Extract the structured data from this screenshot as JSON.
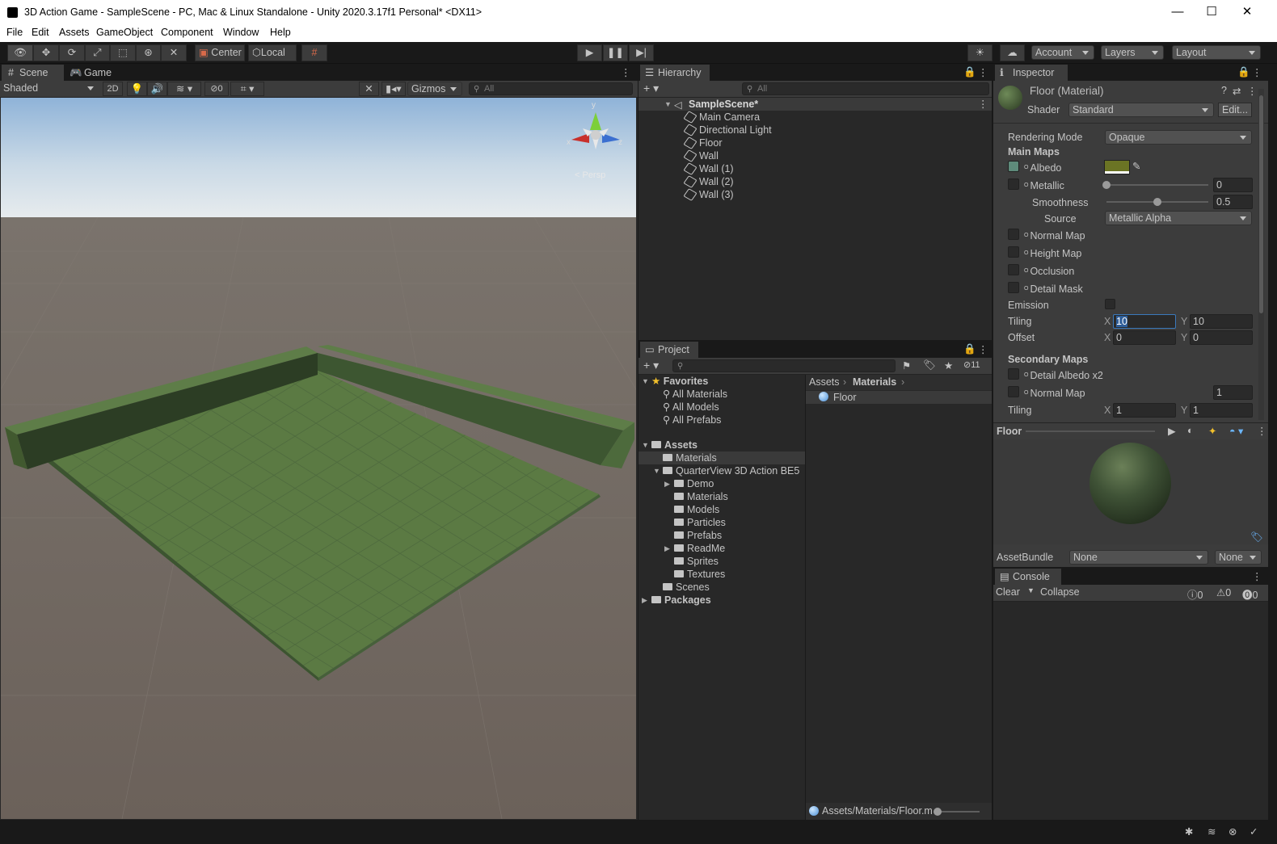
{
  "window": {
    "title": "3D Action Game - SampleScene - PC, Mac & Linux Standalone - Unity 2020.3.17f1 Personal* <DX11>",
    "minimize": "—",
    "maximize": "☐",
    "close": "✕"
  },
  "menu": [
    "File",
    "Edit",
    "Assets",
    "GameObject",
    "Component",
    "Window",
    "Help"
  ],
  "toolbar": {
    "pivot": "Center",
    "space": "Local",
    "account": "Account",
    "layers": "Layers",
    "layout": "Layout"
  },
  "scene": {
    "tabs": [
      "Scene",
      "Game"
    ],
    "shading": "Shaded",
    "mode2d": "2D",
    "hidden_count": "0",
    "gizmos": "Gizmos",
    "search_placeholder": "All",
    "gizmo_y": "y",
    "gizmo_x": "x",
    "gizmo_z": "z",
    "persp": "< Persp"
  },
  "hierarchy": {
    "title": "Hierarchy",
    "search_placeholder": "All",
    "scene_name": "SampleScene*",
    "items": [
      "Main Camera",
      "Directional Light",
      "Floor",
      "Wall",
      "Wall (1)",
      "Wall (2)",
      "Wall (3)"
    ]
  },
  "project": {
    "title": "Project",
    "hidden_count": "11",
    "favorites_label": "Favorites",
    "favorites": [
      "All Materials",
      "All Models",
      "All Prefabs"
    ],
    "assets_label": "Assets",
    "materials": "Materials",
    "quarterview": "QuarterView 3D Action BE5",
    "quarterview_children": [
      "Demo",
      "Materials",
      "Models",
      "Particles",
      "Prefabs",
      "ReadMe",
      "Sprites",
      "Textures"
    ],
    "scenes": "Scenes",
    "packages": "Packages",
    "breadcrumb": [
      "Assets",
      "Materials"
    ],
    "files": [
      "Floor"
    ],
    "footer_path": "Assets/Materials/Floor.m"
  },
  "inspector": {
    "title": "Inspector",
    "object_name": "Floor (Material)",
    "shader_label": "Shader",
    "shader_value": "Standard",
    "edit_button": "Edit...",
    "rendering_mode_label": "Rendering Mode",
    "rendering_mode_value": "Opaque",
    "main_maps": "Main Maps",
    "albedo": "Albedo",
    "albedo_color": "#6b7424",
    "metallic": "Metallic",
    "metallic_value": "0",
    "metallic_fraction": 0,
    "smoothness": "Smoothness",
    "smoothness_value": "0.5",
    "smoothness_fraction": 0.5,
    "source": "Source",
    "source_value": "Metallic Alpha",
    "normal_map": "Normal Map",
    "height_map": "Height Map",
    "occlusion": "Occlusion",
    "detail_mask": "Detail Mask",
    "emission": "Emission",
    "tiling": "Tiling",
    "tiling_x": "10",
    "tiling_y": "10",
    "offset": "Offset",
    "offset_x": "0",
    "offset_y": "0",
    "secondary_maps": "Secondary Maps",
    "detail_albedo": "Detail Albedo x2",
    "secondary_normal_map": "Normal Map",
    "secondary_normal_value": "1",
    "secondary_tiling": "Tiling",
    "secondary_tiling_x": "1",
    "secondary_tiling_y": "1",
    "x_label": "X",
    "y_label": "Y",
    "preview_title": "Floor",
    "assetbundle_label": "AssetBundle",
    "assetbundle_value": "None",
    "assetbundle_variant": "None"
  },
  "console": {
    "title": "Console",
    "clear": "Clear",
    "collapse": "Collapse",
    "log_count": "0",
    "warn_count": "0",
    "error_count": "0"
  }
}
